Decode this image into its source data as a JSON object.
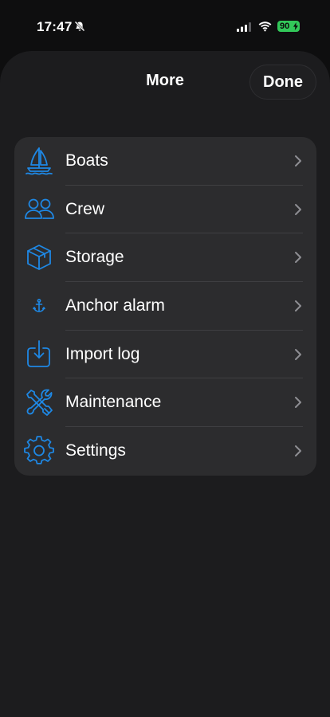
{
  "status_bar": {
    "time": "17:47",
    "battery_level": "90"
  },
  "header": {
    "title": "More",
    "done_label": "Done"
  },
  "menu": {
    "items": [
      {
        "label": "Boats",
        "icon": "sailboat-icon"
      },
      {
        "label": "Crew",
        "icon": "people-icon"
      },
      {
        "label": "Storage",
        "icon": "box-icon"
      },
      {
        "label": "Anchor alarm",
        "icon": "anchor-icon"
      },
      {
        "label": "Import log",
        "icon": "import-icon"
      },
      {
        "label": "Maintenance",
        "icon": "tools-icon"
      },
      {
        "label": "Settings",
        "icon": "gear-icon"
      }
    ]
  },
  "colors": {
    "accent": "#1e88e5",
    "sheet_background": "#1c1c1e",
    "card_background": "#2c2c2e",
    "battery": "#32c759"
  }
}
